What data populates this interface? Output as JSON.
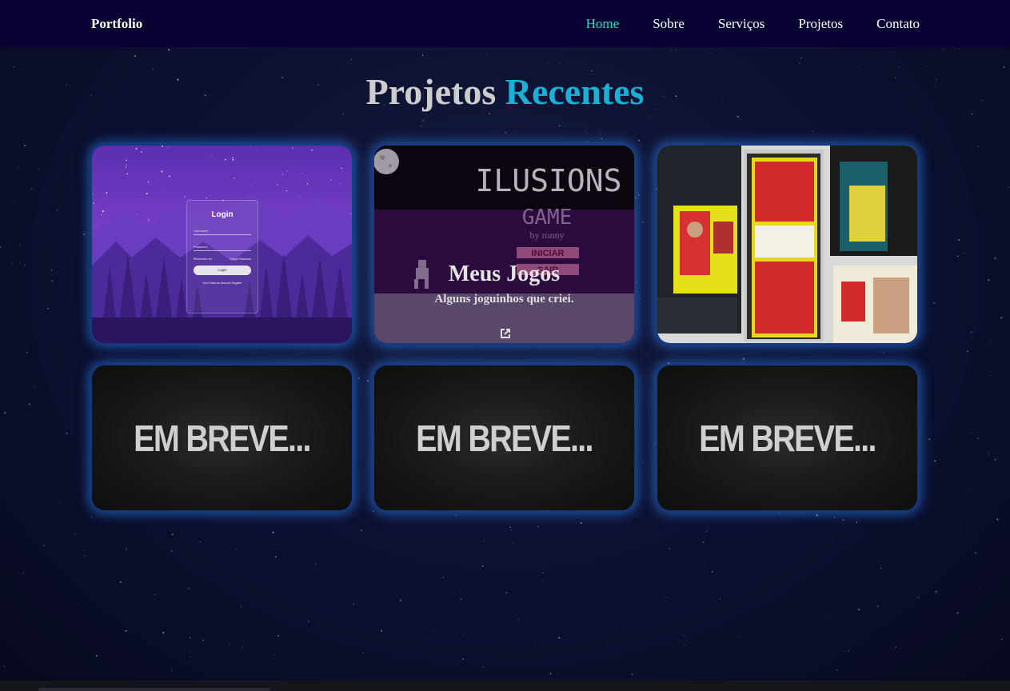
{
  "nav": {
    "brand": "Portfolio",
    "links": [
      {
        "label": "Home",
        "active": true
      },
      {
        "label": "Sobre",
        "active": false
      },
      {
        "label": "Serviços",
        "active": false
      },
      {
        "label": "Projetos",
        "active": false
      },
      {
        "label": "Contato",
        "active": false
      }
    ]
  },
  "section": {
    "title_part1": "Projetos",
    "title_part2": "Recentes"
  },
  "projects": [
    {
      "id": "login",
      "screenshot": {
        "title": "Login",
        "username_placeholder": "Username",
        "password_placeholder": "Password",
        "remember": "Remember me",
        "forgot": "Forgot Password",
        "button": "Login",
        "register": "Don't have an account Register"
      }
    },
    {
      "id": "game",
      "title": "Meus Jogos",
      "description": "Alguns joguinhos que criei.",
      "screenshot": {
        "game_title": "ILUSIONS",
        "game_subtitle": "GAME",
        "author": "by ronny",
        "start": "INICIAR",
        "exit": "SAIR"
      }
    },
    {
      "id": "party",
      "screenshot": {}
    },
    {
      "id": "soon-1",
      "placeholder": "EM BREVE..."
    },
    {
      "id": "soon-2",
      "placeholder": "EM BREVE..."
    },
    {
      "id": "soon-3",
      "placeholder": "EM BREVE..."
    }
  ],
  "colors": {
    "nav_bg": "#080333",
    "accent": "#1fe0c2",
    "title_accent": "#19b2d6",
    "card_glow": "#2878e6"
  }
}
